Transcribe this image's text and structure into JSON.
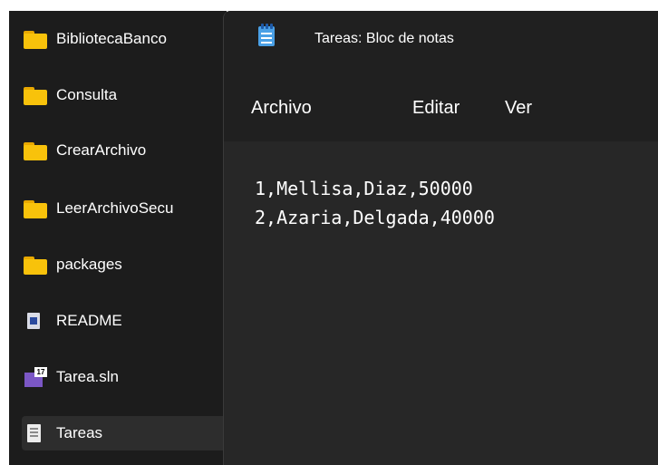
{
  "explorer": {
    "items": [
      {
        "label": "BibliotecaBanco",
        "icon": "folder-icon"
      },
      {
        "label": "Consulta",
        "icon": "folder-icon"
      },
      {
        "label": "CrearArchivo",
        "icon": "folder-icon"
      },
      {
        "label": "LeerArchivoSecu",
        "icon": "folder-icon"
      },
      {
        "label": "packages",
        "icon": "folder-icon"
      },
      {
        "label": "README",
        "icon": "readme-icon"
      },
      {
        "label": "Tarea.sln",
        "icon": "visual-studio-solution-icon"
      },
      {
        "label": "Tareas",
        "icon": "text-file-icon",
        "selected": true
      }
    ]
  },
  "notepad": {
    "title": "Tareas: Bloc de notas",
    "menu": [
      "Archivo",
      "Editar",
      "Ver"
    ],
    "content": [
      "1,Mellisa,Diaz,50000",
      "2,Azaria,Delgada,40000"
    ]
  },
  "colors": {
    "folder": "#f8c20b",
    "explorer_bg": "#1c1c1c",
    "notepad_bg": "#272727",
    "titlebar_bg": "#202020"
  }
}
